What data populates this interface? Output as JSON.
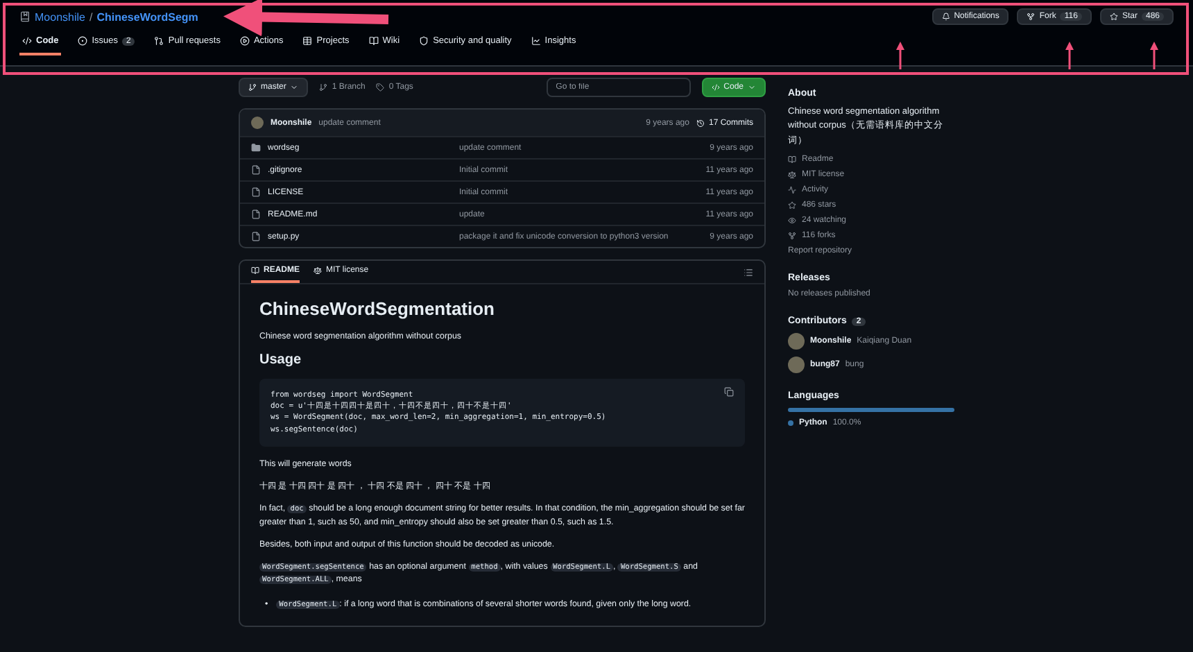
{
  "repo": {
    "owner": "Moonshile",
    "separator": "/",
    "name": "ChineseWordSegm"
  },
  "header_actions": [
    {
      "kind": "notifications",
      "label": "Notifications"
    },
    {
      "kind": "fork",
      "label": "Fork",
      "count": "116"
    },
    {
      "kind": "star",
      "label": "Star",
      "count": "486"
    }
  ],
  "tabs": [
    {
      "label": "Code",
      "selected": true
    },
    {
      "label": "Issues",
      "count": "2",
      "selected": false
    },
    {
      "label": "Pull requests",
      "selected": false
    },
    {
      "label": "Actions",
      "selected": false
    },
    {
      "label": "Projects",
      "selected": false
    },
    {
      "label": "Wiki",
      "selected": false
    },
    {
      "label": "Security and quality",
      "selected": false
    },
    {
      "label": "Insights",
      "selected": false
    }
  ],
  "toolbar": {
    "branch": "master",
    "branches": "1 Branch",
    "tags": "0 Tags",
    "search": {
      "placeholder": "Go to file"
    },
    "code_button": "Code"
  },
  "latest_commit": {
    "author": "Moonshile",
    "message": "update comment",
    "age": "9 years ago",
    "commits": "17 Commits"
  },
  "files": [
    {
      "kind": "folder",
      "name": "wordseg",
      "message": "update comment",
      "age": "9 years ago"
    },
    {
      "kind": "file",
      "name": ".gitignore",
      "message": "Initial commit",
      "age": "11 years ago"
    },
    {
      "kind": "file",
      "name": "LICENSE",
      "message": "Initial commit",
      "age": "11 years ago"
    },
    {
      "kind": "file",
      "name": "README.md",
      "message": "update",
      "age": "11 years ago"
    },
    {
      "kind": "file",
      "name": "setup.py",
      "message": "package it and fix unicode conversion to python3 version",
      "age": "9 years ago"
    }
  ],
  "readme_tabs": [
    {
      "label": "README",
      "selected": true
    },
    {
      "label": "MIT license",
      "selected": false
    }
  ],
  "readme": {
    "title": "ChineseWordSegmentation",
    "intro": "Chinese word segmentation algorithm without corpus",
    "usage_heading": "Usage",
    "code": [
      "from wordseg import WordSegment",
      "doc = u'十四是十四四十是四十，十四不是四十，四十不是十四'",
      "ws = WordSegment(doc, max_word_len=2, min_aggregation=1, min_entropy=0.5)",
      "ws.segSentence(doc)"
    ],
    "paragraphs": [
      [
        {
          "kind": "text",
          "text": "This will generate words"
        }
      ],
      [
        {
          "kind": "text",
          "text": "十四 是 十四 四十 是 四十 ， 十四 不是 四十 ， 四十 不是 十四"
        }
      ],
      [
        {
          "kind": "text",
          "text": "In fact, "
        },
        {
          "kind": "code",
          "text": "doc"
        },
        {
          "kind": "text",
          "text": " should be a long enough document string for better results. In that condition, the min_aggregation should be set far greater than 1, such as 50, and min_entropy should also be set greater than 0.5, such as 1.5."
        }
      ],
      [
        {
          "kind": "text",
          "text": "Besides, both input and output of this function should be decoded as unicode."
        }
      ],
      [
        {
          "kind": "code",
          "text": "WordSegment.segSentence"
        },
        {
          "kind": "text",
          "text": " has an optional argument "
        },
        {
          "kind": "code",
          "text": "method"
        },
        {
          "kind": "text",
          "text": ", with values "
        },
        {
          "kind": "code",
          "text": "WordSegment.L"
        },
        {
          "kind": "text",
          "text": ", "
        },
        {
          "kind": "code",
          "text": "WordSegment.S"
        },
        {
          "kind": "text",
          "text": " and "
        },
        {
          "kind": "code",
          "text": "WordSegment.ALL"
        },
        {
          "kind": "text",
          "text": ", means"
        }
      ]
    ],
    "bullets": [
      [
        {
          "kind": "marker",
          "text": "•"
        },
        {
          "kind": "code",
          "text": "WordSegment.L"
        },
        {
          "kind": "text",
          "text": ": if a long word that is combinations of several shorter words found, given only the long word."
        }
      ]
    ]
  },
  "about": {
    "heading": "About",
    "description": "Chinese word segmentation algorithm without corpus（无需语料库的中文分词）",
    "items": [
      {
        "label": "Readme"
      },
      {
        "label": "MIT license"
      },
      {
        "label": "Activity"
      },
      {
        "label": "486 stars"
      },
      {
        "label": "24 watching"
      },
      {
        "label": "116 forks"
      }
    ],
    "report": "Report repository"
  },
  "releases": {
    "heading": "Releases",
    "text": "No releases published"
  },
  "contributors": {
    "heading": "Contributors",
    "count": "2",
    "people": [
      {
        "login": "Moonshile",
        "name": "Kaiqiang Duan"
      },
      {
        "login": "bung87",
        "name": "bung"
      }
    ]
  },
  "languages": {
    "heading": "Languages",
    "items": [
      {
        "name": "Python",
        "share": "100.0%",
        "color": "#3572a5"
      }
    ]
  }
}
